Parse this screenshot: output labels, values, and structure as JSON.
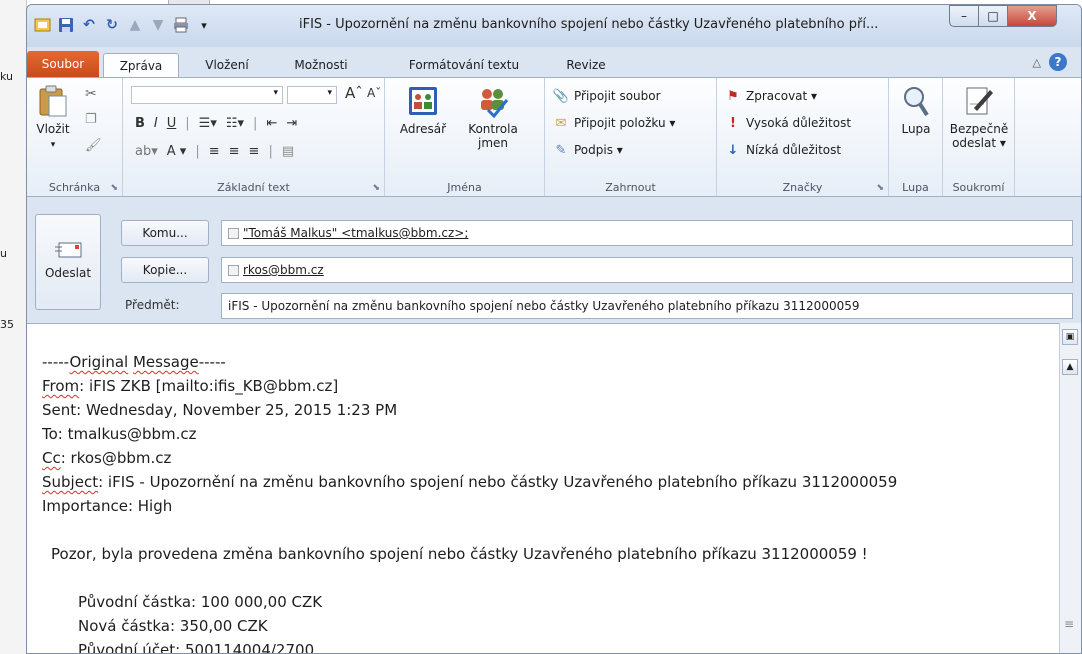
{
  "background": {
    "frag1": "ku",
    "frag2": "u",
    "frag3": "35"
  },
  "window": {
    "title": "iFIS - Upozornění na změnu bankovního spojení nebo částky Uzavřeného platebního pří...",
    "controls": {
      "minimize": "–",
      "maximize": "□",
      "close": "X"
    }
  },
  "tabs": [
    "Soubor",
    "Zpráva",
    "Vložení",
    "Možnosti",
    "Formátování textu",
    "Revize"
  ],
  "ribbon": {
    "clipboard": {
      "paste": "Vložit",
      "label": "Schránka"
    },
    "basic_text": {
      "label": "Základní text",
      "bold": "B",
      "italic": "I",
      "underline": "U",
      "font_color": "A"
    },
    "names": {
      "address_book": "Adresář",
      "check_names_1": "Kontrola",
      "check_names_2": "jmen",
      "label": "Jména"
    },
    "include": {
      "attach_file": "Připojit soubor",
      "attach_item": "Připojit položku ▾",
      "signature": "Podpis ▾",
      "label": "Zahrnout"
    },
    "tags": {
      "follow_up": "Zpracovat ▾",
      "high": "Vysoká důležitost",
      "low": "Nízká důležitost",
      "label": "Značky"
    },
    "zoom": {
      "button": "Lupa",
      "label": "Lupa"
    },
    "privacy": {
      "button_1": "Bezpečně",
      "button_2": "odeslat ▾",
      "label": "Soukromí"
    }
  },
  "header": {
    "send": "Odeslat",
    "to_button": "Komu...",
    "cc_button": "Kopie...",
    "subject_label": "Předmět:",
    "to_value": "\"Tomáš Malkus\" <tmalkus@bbm.cz>;",
    "cc_value": "rkos@bbm.cz",
    "subject_value": "iFIS - Upozornění na změnu bankovního spojení nebo částky Uzavřeného platebního příkazu 3112000059"
  },
  "message": {
    "l1_a": "-----",
    "l1_b": "Original",
    "l1_c": " ",
    "l1_d": "Message",
    "l1_e": "-----",
    "l2_a": "From",
    "l2_b": ": iFIS ZKB [mailto:ifis_KB@bbm.cz]",
    "l3": "Sent: Wednesday, November 25, 2015 1:23 PM",
    "l4": "To: tmalkus@bbm.cz",
    "l5_a": "Cc",
    "l5_b": ": rkos@bbm.cz",
    "l6_a": "Subject",
    "l6_b": ": iFIS - Upozornění na změnu bankovního spojení nebo částky Uzavřeného platebního příkazu 3112000059",
    "l7": "Importance: High",
    "l8": "Pozor, byla provedena změna bankovního spojení nebo částky Uzavřeného platebního příkazu 3112000059 !",
    "l9": "Původní částka: 100 000,00 CZK",
    "l10": "Nová částka: 350,00 CZK",
    "l11": "Původní účet: 500114004/2700"
  }
}
